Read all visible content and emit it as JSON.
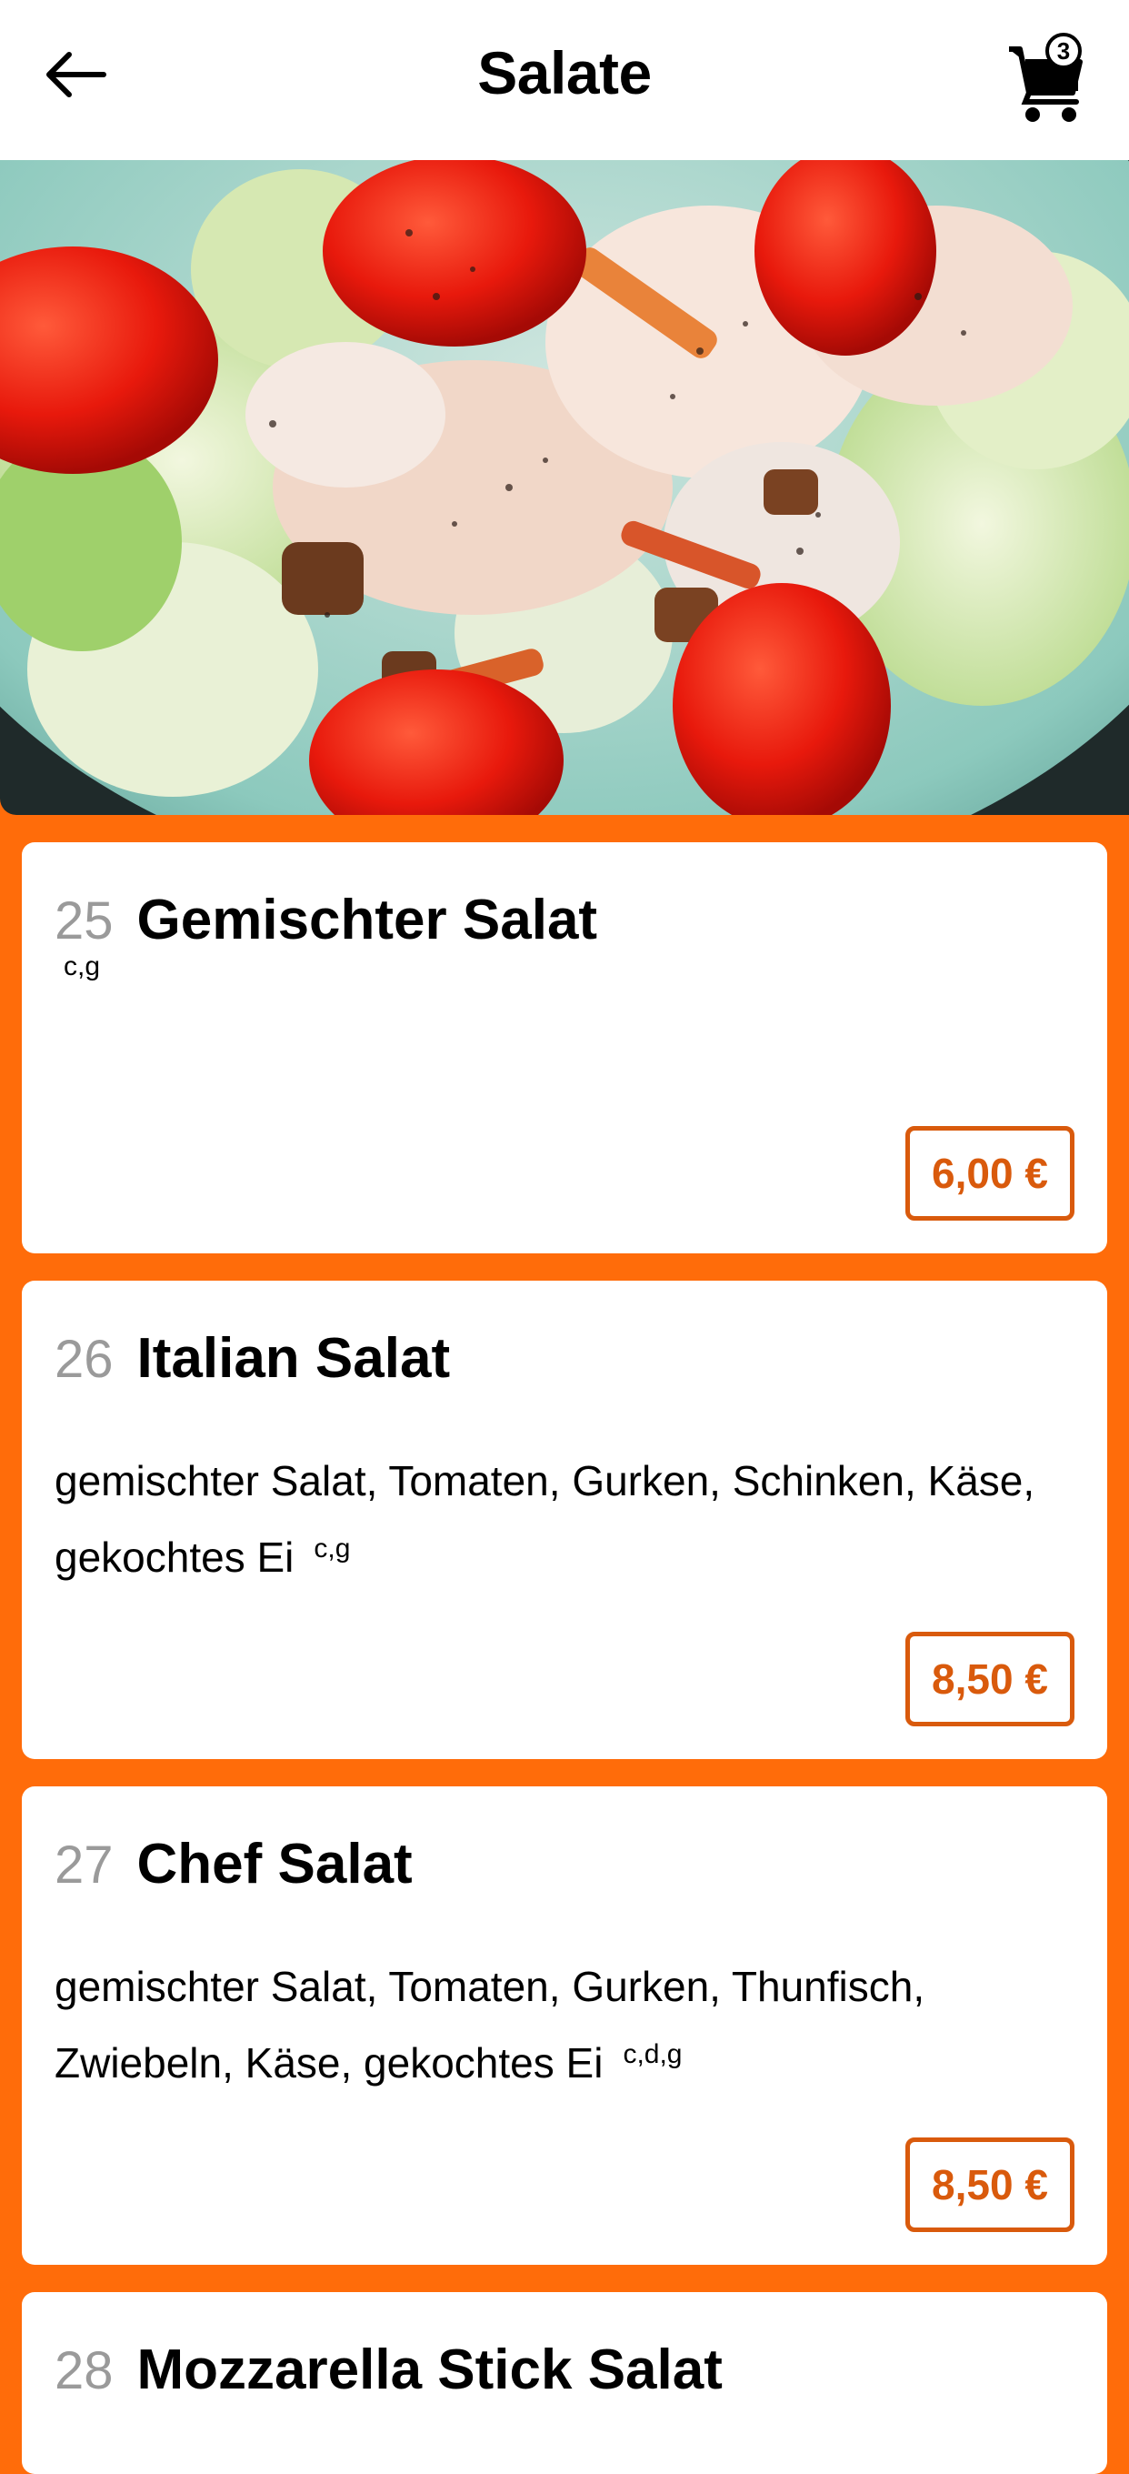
{
  "header": {
    "title": "Salate",
    "cart_count": "3",
    "back_icon": "arrow-left-icon",
    "cart_icon": "shopping-cart-icon"
  },
  "hero": {
    "image": "salad-bowl-photo"
  },
  "colors": {
    "background": "#ff6c0a",
    "accent": "#d95a0c",
    "item_number": "#9a9a9a"
  },
  "items": [
    {
      "number": "25",
      "name": "Gemischter Salat",
      "description": "",
      "allergens": "c,g",
      "price": "6,00 €"
    },
    {
      "number": "26",
      "name": "Italian Salat",
      "description_line1": "gemischter Salat, Tomaten, Gurken, Schinken, Käse,",
      "description_line2": "gekochtes Ei",
      "allergens": "c,g",
      "price": "8,50 €"
    },
    {
      "number": "27",
      "name": "Chef Salat",
      "description_line1": "gemischter Salat, Tomaten, Gurken, Thunfisch,",
      "description_line2": "Zwiebeln, Käse, gekochtes Ei",
      "allergens": "c,d,g",
      "price": "8,50 €"
    },
    {
      "number": "28",
      "name": "Mozzarella Stick Salat"
    }
  ]
}
